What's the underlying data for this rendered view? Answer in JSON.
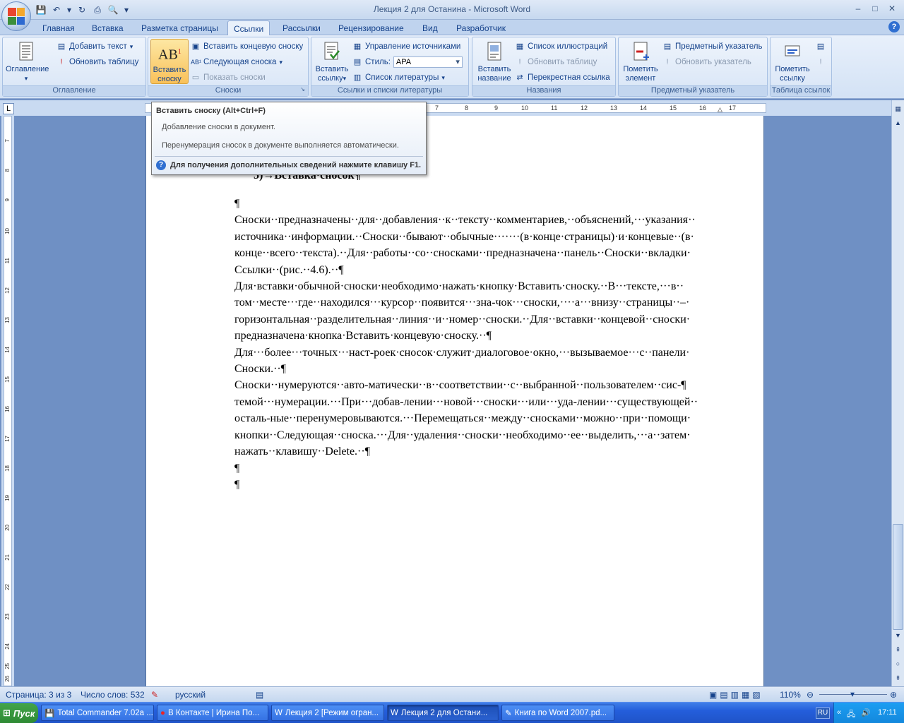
{
  "window": {
    "title": "Лекция 2 для Останина - Microsoft Word",
    "min": "–",
    "max": "□",
    "close": "✕"
  },
  "tabs": [
    "Главная",
    "Вставка",
    "Разметка страницы",
    "Ссылки",
    "Рассылки",
    "Рецензирование",
    "Вид",
    "Разработчик"
  ],
  "active_tab": "Ссылки",
  "ribbon": {
    "toc": {
      "big": "Оглавление",
      "add_text": "Добавить текст",
      "update": "Обновить таблицу",
      "group": "Оглавление"
    },
    "footnotes": {
      "big_line1": "Вставить",
      "big_line2": "сноску",
      "insert_endnote": "Вставить концевую сноску",
      "next": "Следующая сноска",
      "show": "Показать сноски",
      "group": "Сноски"
    },
    "citations": {
      "big_line1": "Вставить",
      "big_line2": "ссылку",
      "manage": "Управление источниками",
      "style_label": "Стиль:",
      "style_value": "APA",
      "bibliography": "Список литературы",
      "group": "Ссылки и списки литературы"
    },
    "captions": {
      "big_line1": "Вставить",
      "big_line2": "название",
      "figures": "Список иллюстраций",
      "update": "Обновить таблицу",
      "cross": "Перекрестная ссылка",
      "group": "Названия"
    },
    "index": {
      "big_line1": "Пометить",
      "big_line2": "элемент",
      "insert": "Предметный указатель",
      "update": "Обновить указатель",
      "group": "Предметный указатель"
    },
    "toa": {
      "big_line1": "Пометить",
      "big_line2": "ссылку",
      "group": "Таблица ссылок"
    }
  },
  "tooltip": {
    "title": "Вставить сноску (Alt+Ctrl+F)",
    "line1": "Добавление сноски в документ.",
    "line2": "Перенумерация сносок в документе выполняется автоматически.",
    "help": "Для получения дополнительных сведений нажмите клавишу F1."
  },
  "ruler": {
    "h_ticks": [
      "7",
      "8",
      "9",
      "10",
      "11",
      "12",
      "13",
      "14",
      "15",
      "16",
      "17"
    ],
    "v_ticks": [
      "7",
      "8",
      "9",
      "10",
      "11",
      "12",
      "13",
      "14",
      "15",
      "16",
      "17",
      "18",
      "19",
      "20",
      "21",
      "22",
      "23",
      "24",
      "25",
      "26"
    ]
  },
  "document": {
    "heading": "5)→Вставка·сносок¶",
    "empty1": "¶",
    "p1": "Сноски··предназначены··для··добавления··к··тексту··комментариев,··объяснений,···указания·· источника··информации.··Сноски··бывают··обычные·······(в·конце·страницы)·и·концевые··(в· конце··всего··текста).··Для··работы··со··сносками··предназначена··панель··Сноски··вкладки· Ссылки··(рис.··4.6).··¶",
    "p2": "Для·вставки·обычной·сноски·необходимо·нажать·кнопку·Вставить·сноску.··В···тексте,···в·· том··месте···где··находился···курсор··появится···зна-чок···сноски,····а···внизу··страницы··–· горизонтальная··разделительная··линия··и··номер··сноски.··Для··вставки··концевой··сноски· предназначена·кнопка·Вставить·концевую·сноску.··¶",
    "p3": "Для···более···точных···наст-роек·сносок·служит·диалоговое·окно,···вызываемое···с··панели· Сноски.··¶",
    "p4": "Сноски··нумеруются··авто-матически··в··соответствии··с··выбранной··пользователем··сис-¶ темой···нумерации.···При···добав-лении···новой···сноски···или···уда-лении···существующей·· осталь-ные··перенумеровываются.···Перемещаться··между··сносками··можно··при··помощи· кнопки··Следующая··сноска.···Для··удаления··сноски··необходимо··ее··выделить,···а··затем· нажать··клавишу··Delete.··¶",
    "empty2": "¶",
    "empty3": "¶"
  },
  "status": {
    "page": "Страница: 3 из 3",
    "words": "Число слов: 532",
    "lang": "русский",
    "zoom": "110%"
  },
  "taskbar": {
    "start": "Пуск",
    "items": [
      "Total Commander 7.02a ...",
      "В Контакте | Ирина По...",
      "Лекция 2 [Режим огран...",
      "Лекция 2 для Остани...",
      "Книга по Word 2007.pd..."
    ],
    "lang": "RU",
    "time": "17:11"
  },
  "colors": {
    "accent": "#15428b",
    "pressed": "#f9c15a"
  }
}
